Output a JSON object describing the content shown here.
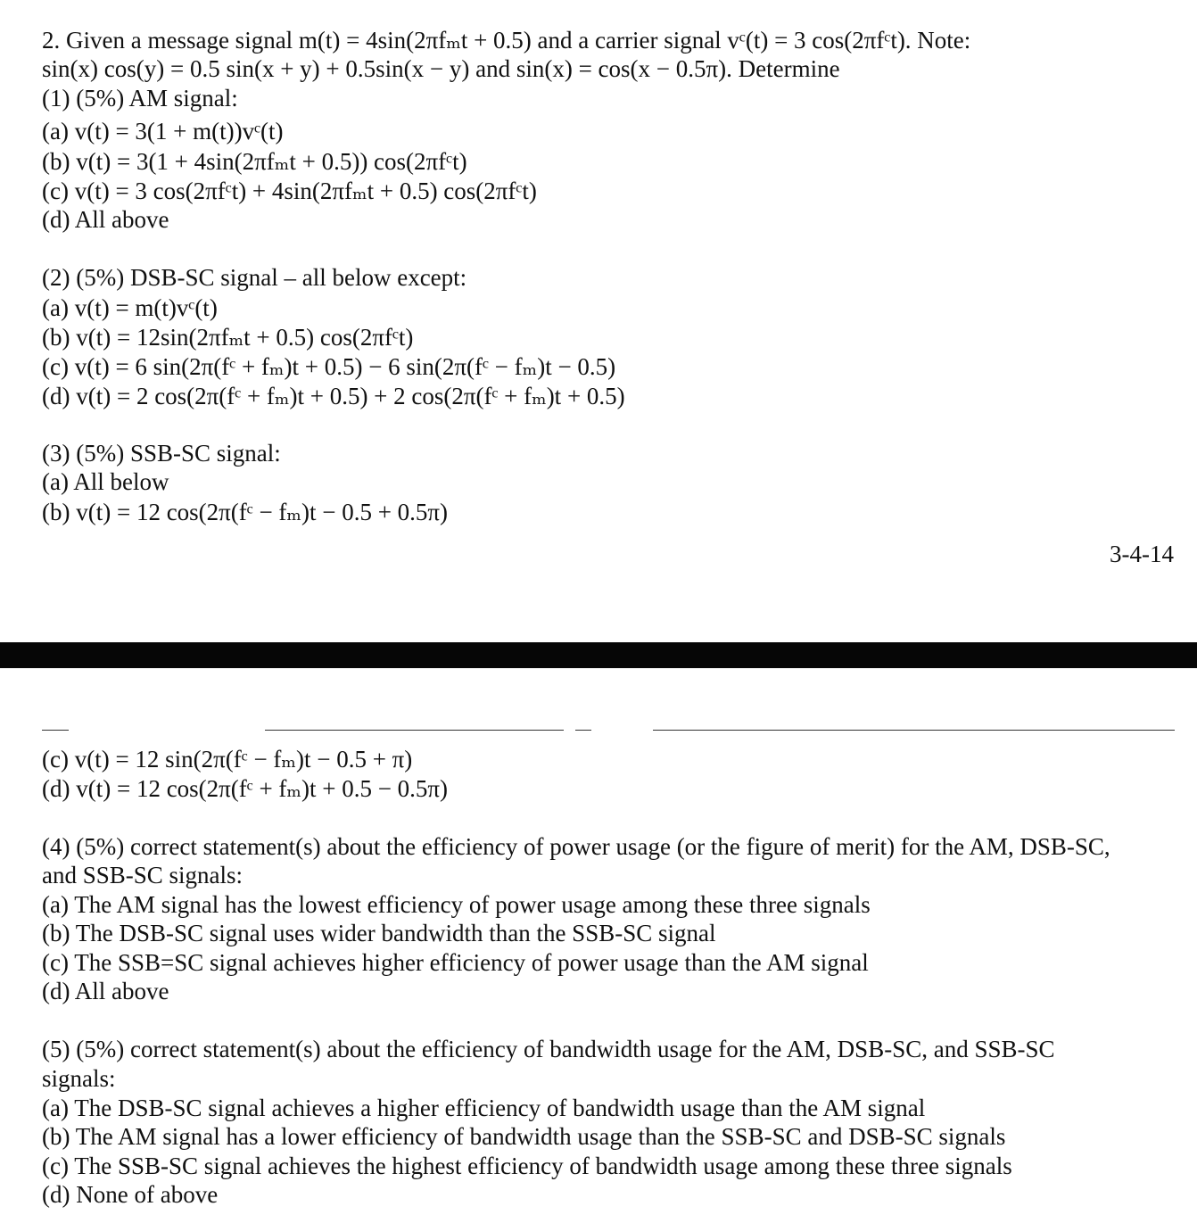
{
  "document": {
    "intro": {
      "line1": "2.  Given a message signal m(t) = 4sin(2πfₘt + 0.5) and a carrier signal vᶜ(t) = 3 cos(2πfᶜt). Note:",
      "line2": "sin(x) cos(y) = 0.5 sin(x + y) + 0.5sin(x − y) and sin(x) = cos(x − 0.5π). Determine"
    },
    "q1": {
      "heading": "(1) (5%) AM signal:",
      "options": [
        "(a) v(t) = 3(1 + m(t))vᶜ(t)",
        "(b) v(t) = 3(1 + 4sin(2πfₘt + 0.5)) cos(2πfᶜt)",
        "(c) v(t) = 3 cos(2πfᶜt) + 4sin(2πfₘt + 0.5) cos(2πfᶜt)",
        "(d) All above"
      ]
    },
    "q2": {
      "heading": "(2) (5%) DSB-SC signal – all below except:",
      "options": [
        "(a) v(t) = m(t)vᶜ(t)",
        "(b) v(t) = 12sin(2πfₘt + 0.5) cos(2πfᶜt)",
        "(c) v(t) = 6 sin(2π(fᶜ + fₘ)t + 0.5) − 6 sin(2π(fᶜ − fₘ)t − 0.5)",
        "(d) v(t) = 2 cos(2π(fᶜ + fₘ)t + 0.5) + 2 cos(2π(fᶜ + fₘ)t + 0.5)"
      ]
    },
    "q3": {
      "heading": "(3) (5%) SSB-SC signal:",
      "options": [
        "(a) All below",
        "(b) v(t) = 12 cos(2π(fᶜ − fₘ)t − 0.5 + 0.5π)",
        "(c) v(t) = 12 sin(2π(fᶜ − fₘ)t − 0.5 + π)",
        "(d) v(t) = 12 cos(2π(fᶜ + fₘ)t + 0.5 − 0.5π)"
      ]
    },
    "page_number": "3-4-14",
    "q4": {
      "heading_line1": "(4) (5%) correct statement(s) about the efficiency of power usage (or the figure of merit) for the AM, DSB-SC,",
      "heading_line2": "and SSB-SC signals:",
      "options": [
        "(a) The AM signal has the lowest efficiency of power usage among these three signals",
        "(b) The DSB-SC signal uses wider bandwidth than the SSB-SC signal",
        "(c) The SSB=SC signal achieves higher efficiency of power usage than the AM signal",
        "(d) All above"
      ]
    },
    "q5": {
      "heading_line1": "(5) (5%) correct statement(s) about the efficiency of bandwidth usage for the AM, DSB-SC, and SSB-SC",
      "heading_line2": "signals:",
      "options": [
        "(a) The DSB-SC signal achieves a higher efficiency of bandwidth usage than the AM signal",
        "(b) The AM signal has a lower efficiency of bandwidth usage than the SSB-SC and DSB-SC signals",
        "(c) The SSB-SC signal achieves the highest efficiency of bandwidth usage among these three signals",
        "(d) None of above"
      ]
    }
  }
}
